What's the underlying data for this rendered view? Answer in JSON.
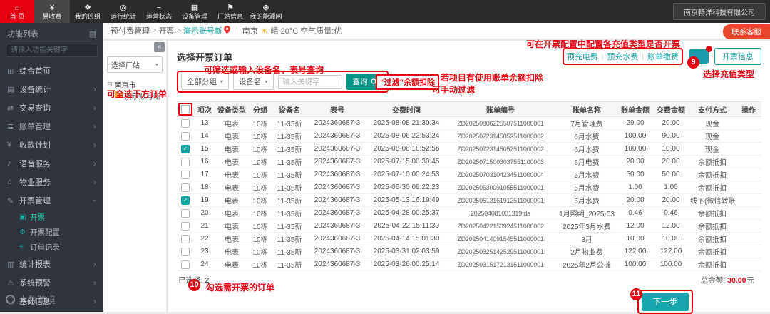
{
  "accent": "#12a3a3",
  "topnav": {
    "items": [
      {
        "id": "home",
        "label": "首 页",
        "icon": "home",
        "home": true
      },
      {
        "id": "billing",
        "label": "易收费",
        "icon": "fee",
        "active": true
      },
      {
        "id": "my-team",
        "label": "我的班组",
        "icon": "team"
      },
      {
        "id": "run-stats",
        "label": "运行统计",
        "icon": "stats"
      },
      {
        "id": "op-status",
        "label": "运营状态",
        "icon": "status"
      },
      {
        "id": "device-mgmt",
        "label": "设备管理",
        "icon": "device"
      },
      {
        "id": "station-info",
        "label": "厂站信息",
        "icon": "site"
      },
      {
        "id": "energy-net",
        "label": "我的能源网",
        "icon": "energy"
      }
    ],
    "company": "南京畅洋科技有限公司"
  },
  "sidebar": {
    "title": "功能列表",
    "search_placeholder": "请输入功能关键字",
    "items": [
      {
        "id": "dashboard",
        "label": "综合首页",
        "icon": "dashboard",
        "expandable": false
      },
      {
        "id": "device-stats",
        "label": "设备统计",
        "icon": "devstat",
        "expandable": true
      },
      {
        "id": "trade-query",
        "label": "交易查询",
        "icon": "trade",
        "expandable": true
      },
      {
        "id": "bill-mgmt",
        "label": "账单管理",
        "icon": "bill",
        "expandable": true
      },
      {
        "id": "payment-plan",
        "label": "收款计划",
        "icon": "plan",
        "expandable": true
      },
      {
        "id": "voice-service",
        "label": "语音服务",
        "icon": "voice",
        "expandable": true
      },
      {
        "id": "property-service",
        "label": "物业服务",
        "icon": "property",
        "expandable": true
      },
      {
        "id": "invoice-mgmt",
        "label": "开票管理",
        "icon": "invoice",
        "expandable": true,
        "expanded": true,
        "children": [
          {
            "id": "invoice",
            "label": "开票",
            "icon": "subinvoice",
            "active": true
          },
          {
            "id": "invoice-config",
            "label": "开票配置",
            "icon": "subconfig",
            "active": false
          },
          {
            "id": "order-records",
            "label": "订单记录",
            "icon": "subrecord",
            "active": false
          }
        ]
      },
      {
        "id": "report",
        "label": "统计报表",
        "icon": "report",
        "expandable": true
      },
      {
        "id": "alert",
        "label": "系统预警",
        "icon": "alert",
        "expandable": true
      },
      {
        "id": "basic-info",
        "label": "基础信息",
        "icon": "info",
        "expandable": true
      }
    ],
    "watermark": "大数跨境"
  },
  "breadcrumb": {
    "module": "预付费管理",
    "sep1": ">",
    "page": "开票",
    "sep2": ">",
    "account": "演示账号新",
    "divider": "|",
    "city": "南京",
    "weather": "晴 20°C 空气质量:优",
    "contact": "联系客服"
  },
  "station_panel": {
    "select_label": "选择厂站",
    "city_node": "南京市",
    "account_node": "演示账号新"
  },
  "toolbar": {
    "links": [
      "预充电费",
      "预充水费",
      "账单缴费"
    ],
    "invoice_info": "开票信息"
  },
  "main": {
    "title": "选择开票订单",
    "filters": {
      "group": "全部分组",
      "field": "设备名",
      "keyword_placeholder": "输入关键字",
      "search": "查询"
    },
    "table": {
      "headers": [
        "项次",
        "设备类型",
        "分组",
        "设备名",
        "表号",
        "交费时间",
        "账单编号",
        "账单名称",
        "账单金额",
        "交费金额",
        "支付方式",
        "操作"
      ],
      "rows": [
        {
          "checked": false,
          "index": "13",
          "device_type": "电表",
          "group": "10栋",
          "device_name": "11-35新",
          "meter_no": "2024360687-3",
          "pay_time": "2025-08-08 21:30:34",
          "bill_no": "ZD20250806225507511000001",
          "bill_name": "7月管理费",
          "bill_amount": "29.00",
          "pay_amount": "20.00",
          "pay_method": "现金"
        },
        {
          "checked": false,
          "index": "14",
          "device_type": "电表",
          "group": "10栋",
          "device_name": "11-35新",
          "meter_no": "2024360687-3",
          "pay_time": "2025-08-06 22:53:24",
          "bill_no": "ZD20250723145052511000002",
          "bill_name": "6月水费",
          "bill_amount": "100.00",
          "pay_amount": "90.00",
          "pay_method": "现金"
        },
        {
          "checked": true,
          "index": "15",
          "device_type": "电表",
          "group": "10栋",
          "device_name": "11-35新",
          "meter_no": "2024360687-3",
          "pay_time": "2025-08-06 18:52:56",
          "bill_no": "ZD20250723145052511000002",
          "bill_name": "6月水费",
          "bill_amount": "100.00",
          "pay_amount": "10.00",
          "pay_method": "现金"
        },
        {
          "checked": false,
          "index": "16",
          "device_type": "电表",
          "group": "10栋",
          "device_name": "11-35新",
          "meter_no": "2024360687-3",
          "pay_time": "2025-07-15 00:30:45",
          "bill_no": "ZD20250715003037551100003",
          "bill_name": "6月电费",
          "bill_amount": "20.00",
          "pay_amount": "20.00",
          "pay_method": "余额抵扣"
        },
        {
          "checked": false,
          "index": "17",
          "device_type": "电表",
          "group": "10栋",
          "device_name": "11-35新",
          "meter_no": "2024360687-3",
          "pay_time": "2025-07-10 00:24:53",
          "bill_no": "ZD20250703104234511000004",
          "bill_name": "5月水费",
          "bill_amount": "50.00",
          "pay_amount": "50.00",
          "pay_method": "余额抵扣"
        },
        {
          "checked": false,
          "index": "18",
          "device_type": "电表",
          "group": "10栋",
          "device_name": "11-35新",
          "meter_no": "2024360687-3",
          "pay_time": "2025-06-30 09:22:23",
          "bill_no": "ZD20250630091055511000001",
          "bill_name": "5月水费",
          "bill_amount": "1.00",
          "pay_amount": "1.00",
          "pay_method": "余额抵扣"
        },
        {
          "checked": true,
          "index": "19",
          "device_type": "电表",
          "group": "10栋",
          "device_name": "11-35新",
          "meter_no": "2024360687-3",
          "pay_time": "2025-05-13 16:19:49",
          "bill_no": "ZD20250513161912511000001",
          "bill_name": "5月水费",
          "bill_amount": "20.00",
          "pay_amount": "20.00",
          "pay_method": "线下(微信转账)"
        },
        {
          "checked": false,
          "index": "20",
          "device_type": "电表",
          "group": "10栋",
          "device_name": "11-35新",
          "meter_no": "2024360687-3",
          "pay_time": "2025-04-28 00:25:37",
          "bill_no": "202504081001319fda",
          "bill_name": "1月照明_2025-03",
          "bill_amount": "0.46",
          "pay_amount": "0.46",
          "pay_method": "余额抵扣"
        },
        {
          "checked": false,
          "index": "21",
          "device_type": "电表",
          "group": "10栋",
          "device_name": "11-35新",
          "meter_no": "2024360687-3",
          "pay_time": "2025-04-22 15:11:39",
          "bill_no": "ZD20250422150924511000002",
          "bill_name": "2025年3月水费",
          "bill_amount": "12.00",
          "pay_amount": "12.00",
          "pay_method": "余额抵扣"
        },
        {
          "checked": false,
          "index": "22",
          "device_type": "电表",
          "group": "10栋",
          "device_name": "11-35新",
          "meter_no": "2024360687-3",
          "pay_time": "2025-04-14 15:01:30",
          "bill_no": "ZD20250414091545511000001",
          "bill_name": "3月",
          "bill_amount": "10.00",
          "pay_amount": "10.00",
          "pay_method": "余额抵扣"
        },
        {
          "checked": false,
          "index": "23",
          "device_type": "电表",
          "group": "10栋",
          "device_name": "11-35新",
          "meter_no": "2024360687-3",
          "pay_time": "2025-03-31 02:03:59",
          "bill_no": "ZD20250325142529511000001",
          "bill_name": "2月物业费",
          "bill_amount": "122.00",
          "pay_amount": "122.00",
          "pay_method": "余额抵扣"
        },
        {
          "checked": false,
          "index": "24",
          "device_type": "电表",
          "group": "10栋",
          "device_name": "11-35新",
          "meter_no": "2024360687-3",
          "pay_time": "2025-03-26 00:25:14",
          "bill_no": "ZD20250315172131511000001",
          "bill_name": "2025年2月公摊",
          "bill_amount": "100.00",
          "pay_amount": "100.00",
          "pay_method": "余额抵扣"
        }
      ]
    },
    "footer": {
      "selected_label": "已选择:",
      "selected_count": "2",
      "total_label": "总金额:",
      "total_value": "30.00",
      "total_unit": "元",
      "next": "下一步"
    }
  },
  "annotations": {
    "config_tip": "可在开票配置中配置各充值类型是否开票",
    "step9": "9",
    "step9_text": "选择充值类型",
    "filter_tip": "可筛选或输入设备名、表号查询",
    "balance_filter_box": "“过滤”余额扣除",
    "balance_tip_line1": "若项目有使用账单余额扣除",
    "balance_tip_line2": "可手动过滤",
    "select_all_tip": "可全选下方订单",
    "step10": "10",
    "step10_text": "勾选需开票的订单",
    "step11": "11"
  }
}
